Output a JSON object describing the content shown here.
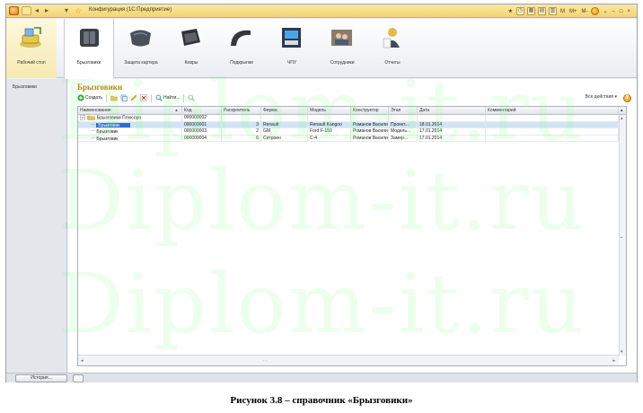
{
  "window": {
    "title": "Конфигурация (1С:Предприятие)",
    "titlebar_right_labels": [
      "M",
      "M+",
      "M-"
    ]
  },
  "sections": [
    {
      "label": "Рабочий стол",
      "icon": "desktop-icon"
    },
    {
      "label": "Брызговики",
      "icon": "mudflap-icon"
    },
    {
      "label": "Защита картера",
      "icon": "crankcase-guard-icon"
    },
    {
      "label": "Ковры",
      "icon": "carpet-icon"
    },
    {
      "label": "Подкрылки",
      "icon": "fender-liner-icon"
    },
    {
      "label": "ЧПУ",
      "icon": "cnc-machine-icon"
    },
    {
      "label": "Сотрудники",
      "icon": "employees-icon"
    },
    {
      "label": "Отчеты",
      "icon": "reports-icon"
    }
  ],
  "left_panel": {
    "items": [
      "Брызговики"
    ]
  },
  "form": {
    "title": "Брызговики",
    "commands": {
      "create": "Создать",
      "find": "Найти...",
      "all_actions": "Все действия"
    },
    "columns": [
      "Наименование",
      "Код",
      "Раскроитель",
      "Фирма",
      "Модель",
      "Конструктор",
      "Этап",
      "Дата",
      "Комментарий"
    ],
    "rows": [
      {
        "type": "group",
        "name": "Брызговики Плюсоро",
        "code": "000000002",
        "cutter": "",
        "firm": "",
        "model": "",
        "designer": "",
        "stage": "",
        "date": "",
        "comment": ""
      },
      {
        "type": "item",
        "name": "Брызговик",
        "code": "000000001",
        "cutter": "3",
        "firm": "Renault",
        "model": "Renault Kangoo",
        "designer": "Романов Василий",
        "stage": "Проект...",
        "date": "18.01.2014",
        "comment": "",
        "selected": true
      },
      {
        "type": "item",
        "name": "Брызговик",
        "code": "000000003",
        "cutter": "2",
        "firm": "GM",
        "model": "Ford F-150",
        "designer": "Романов Василий",
        "stage": "Модель...",
        "date": "17.01.2014",
        "comment": ""
      },
      {
        "type": "item",
        "name": "Брызговик",
        "code": "000000004",
        "cutter": "6",
        "firm": "Ситроен",
        "model": "C-4",
        "designer": "Романов Василий",
        "stage": "Замер...",
        "date": "17.01.2014",
        "comment": ""
      }
    ]
  },
  "statusbar": {
    "history_label": "История..."
  },
  "caption": "Рисунок 3.8 – справочник «Брызговики»",
  "watermark": {
    "text": "Diplom-it.ru"
  },
  "colors": {
    "titlebar": "#f2d474",
    "accent_title": "#b8860b",
    "selection": "#cfe5f7",
    "cursor": "#2f6ad6"
  }
}
